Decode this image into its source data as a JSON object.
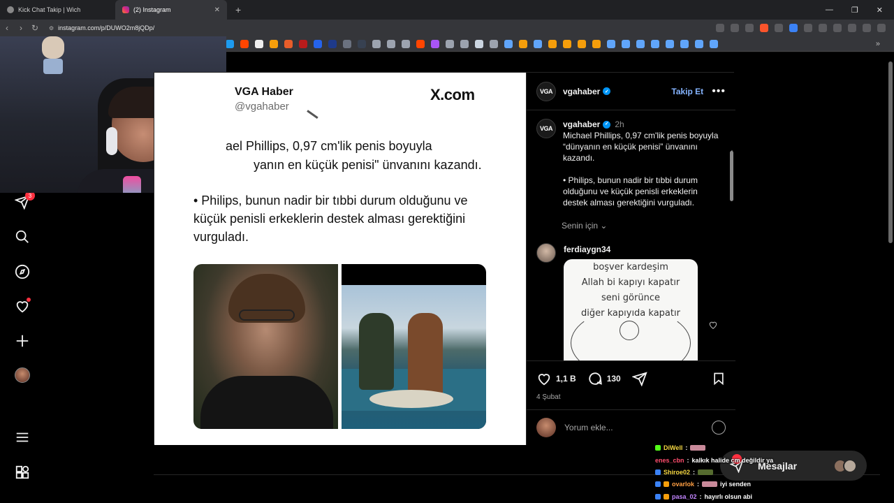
{
  "browser": {
    "tabs": [
      {
        "label": "Kick Chat Takip | Wich",
        "active": false
      },
      {
        "label": "(2) Instagram",
        "active": true
      }
    ],
    "url": "instagram.com/p/DUWO2m8jQDp/"
  },
  "post": {
    "media_tweet": {
      "name": "VGA Haber",
      "handle": "@vgahaber",
      "brand": "X.com",
      "paragraph1_line1": "ael Phillips, 0,97 cm'lik penis boyuyla",
      "paragraph1_line2": "yanın en küçük penisi\" ünvanını kazandı.",
      "paragraph2": "• Philips, bunun nadir bir tıbbi durum olduğunu ve küçük penisli erkeklerin destek alması gerektiğini vurguladı."
    },
    "header": {
      "logo_text": "VGA",
      "username": "vgahaber",
      "follow_label": "Takip Et",
      "more_label": "•••"
    },
    "caption": {
      "username": "vgahaber",
      "time": "2h",
      "text1": "Michael Phillips, 0,97 cm'lik penis boyuyla “dünyanın en küçük penisi” ünvanını kazandı.",
      "text2": "• Philips, bunun nadir bir tıbbi durum olduğunu ve küçük penisli erkeklerin destek alması gerektiğini vurguladı."
    },
    "for_you_label": "Senin için",
    "comment": {
      "username": "ferdiaygn34",
      "image_lines": [
        "boşver kardeşim",
        "Allah bi kapıyı kapatır",
        "seni görünce",
        "diğer kapıyıda kapatır"
      ]
    },
    "actions": {
      "likes": "1,1 B",
      "comments": "130",
      "date": "4 Şubat"
    },
    "comment_placeholder": "Yorum ekle..."
  },
  "sidebar": {
    "notification_count": "3"
  },
  "messages": {
    "label": "Mesajlar"
  },
  "chat": [
    {
      "user": "DiWell",
      "color": "#f5d742",
      "text": ""
    },
    {
      "user": "enes_cbn",
      "color": "#ff4d6d",
      "text": "kalkık halide cm değildir ya"
    },
    {
      "user": "Shiroe02",
      "color": "#f5d742",
      "text": ""
    },
    {
      "user": "ovarlok",
      "color": "#ff9f43",
      "text": "iyi senden"
    },
    {
      "user": "pasa_02",
      "color": "#c084fc",
      "text": "hayırlı olsun abi"
    }
  ]
}
